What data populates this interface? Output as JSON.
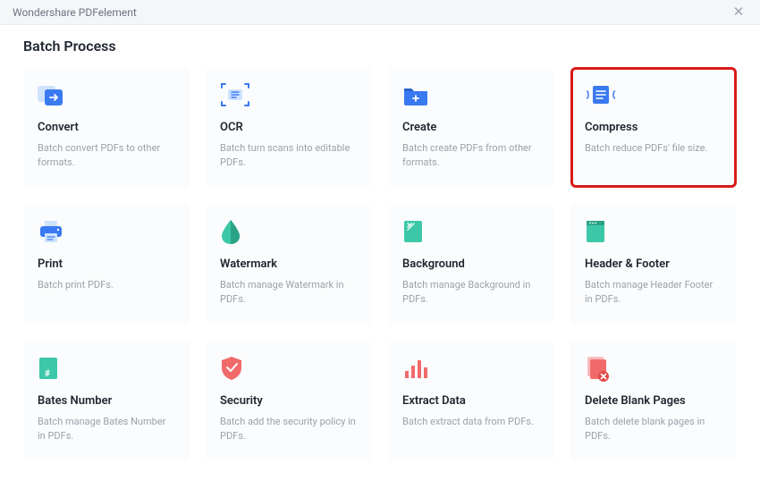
{
  "titlebar": {
    "app_name": "Wondershare PDFelement"
  },
  "heading": "Batch Process",
  "cards": [
    {
      "title": "Convert",
      "desc": "Batch convert PDFs to other formats."
    },
    {
      "title": "OCR",
      "desc": "Batch turn scans into editable PDFs."
    },
    {
      "title": "Create",
      "desc": "Batch create PDFs from other formats."
    },
    {
      "title": "Compress",
      "desc": "Batch reduce PDFs' file size."
    },
    {
      "title": "Print",
      "desc": "Batch print PDFs."
    },
    {
      "title": "Watermark",
      "desc": "Batch manage Watermark in PDFs."
    },
    {
      "title": "Background",
      "desc": "Batch manage Background in PDFs."
    },
    {
      "title": "Header & Footer",
      "desc": "Batch manage Header  Footer in PDFs."
    },
    {
      "title": "Bates Number",
      "desc": "Batch manage Bates Number in PDFs."
    },
    {
      "title": "Security",
      "desc": "Batch add the security policy in PDFs."
    },
    {
      "title": "Extract Data",
      "desc": "Batch extract data from PDFs."
    },
    {
      "title": "Delete Blank Pages",
      "desc": "Batch delete blank pages in PDFs."
    }
  ]
}
